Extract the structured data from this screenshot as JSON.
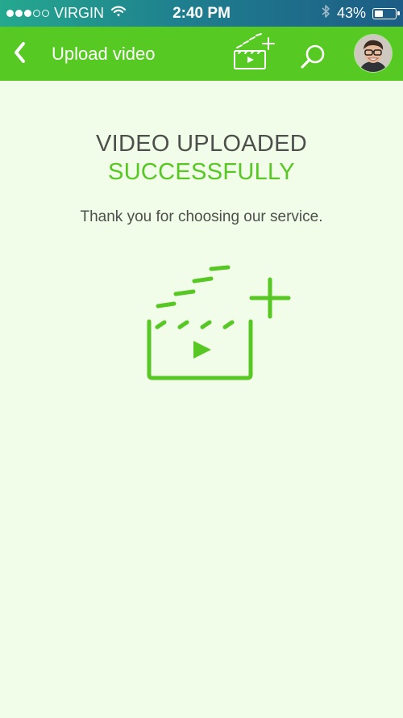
{
  "status_bar": {
    "carrier": "VIRGIN",
    "time": "2:40 PM",
    "battery": "43%",
    "battery_level": 0.43,
    "signal_bars_full": 3,
    "signal_bars_total": 5
  },
  "app_bar": {
    "title": "Upload video",
    "back_icon": "chevron-left-icon",
    "upload_icon": "video-add-icon",
    "search_icon": "search-icon",
    "avatar": "user-avatar"
  },
  "main": {
    "heading_line1": "VIDEO UPLOADED",
    "heading_line2": "SUCCESSFULLY",
    "message": "Thank you for choosing our service.",
    "illustration_icon": "video-add-icon"
  },
  "colors": {
    "accent": "#56c922",
    "background": "#f1fce9",
    "text": "#4d4f4c"
  }
}
